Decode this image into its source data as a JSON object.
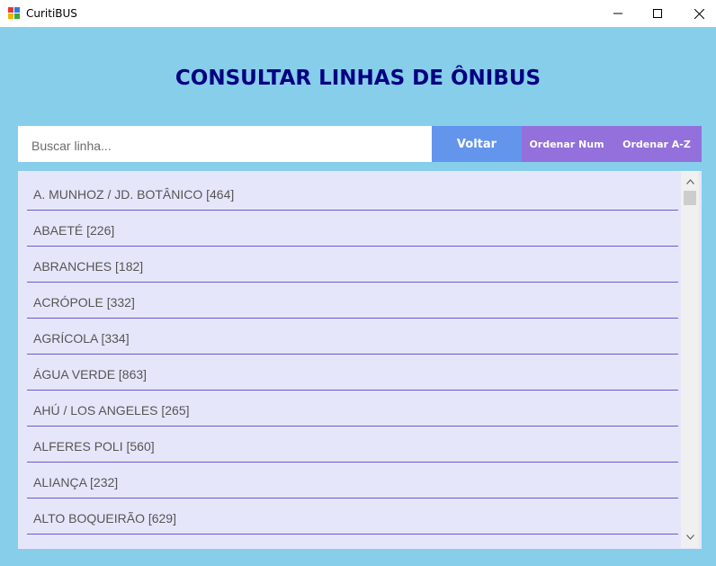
{
  "window": {
    "title": "CuritiBUS",
    "icon": "windows-app-icon",
    "controls": [
      "minimize-icon",
      "maximize-icon",
      "close-icon"
    ]
  },
  "header": {
    "title": "CONSULTAR LINHAS DE ÔNIBUS"
  },
  "search": {
    "placeholder": "Buscar linha..."
  },
  "buttons": {
    "back": "Voltar",
    "sort_num": "Ordenar Num",
    "sort_az": "Ordenar A-Z"
  },
  "lines": [
    "A. MUNHOZ / JD. BOTÂNICO [464]",
    "ABAETÉ [226]",
    "ABRANCHES [182]",
    "ACRÓPOLE [332]",
    "AGRÍCOLA [334]",
    "ÁGUA VERDE [863]",
    "AHÚ / LOS ANGELES [265]",
    "ALFERES POLI [560]",
    "ALIANÇA [232]",
    "ALTO BOQUEIRÃO [629]"
  ],
  "colors": {
    "background": "#87ceeb",
    "heading": "#000080",
    "back_button": "#6495ed",
    "sort_buttons": "#9370db",
    "list_background": "#e6e6fa",
    "list_divider": "#6a5acd"
  }
}
